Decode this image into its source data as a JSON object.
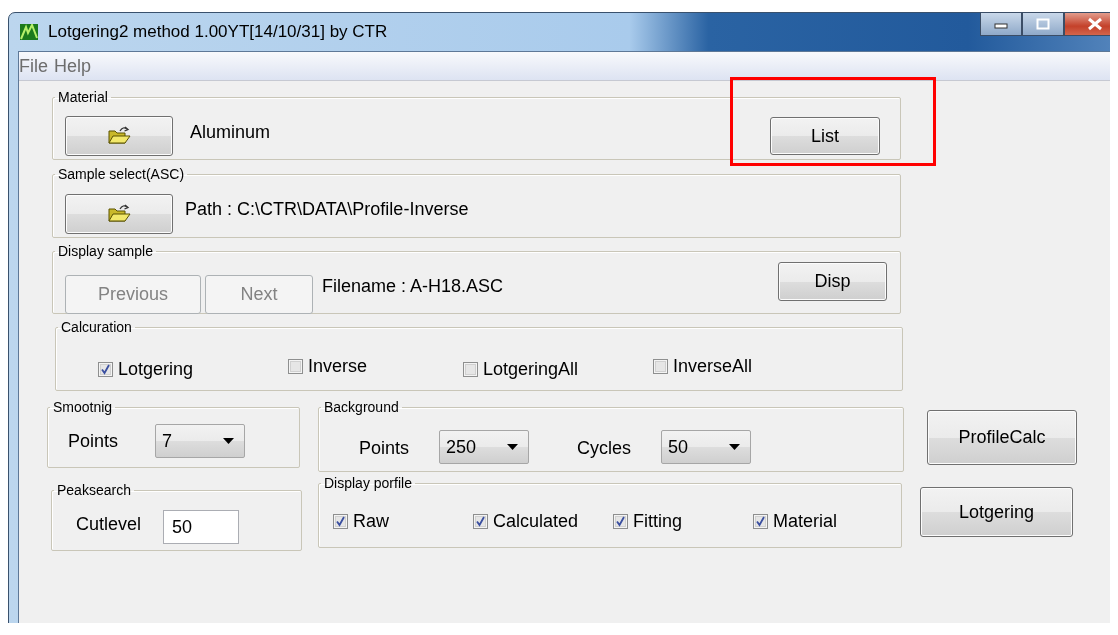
{
  "window": {
    "title": "Lotgering2 method 1.00YT[14/10/31] by CTR"
  },
  "menu": [
    {
      "label": "File"
    },
    {
      "label": "Help"
    }
  ],
  "material": {
    "title": "Material",
    "name": "Aluminum",
    "list_button": "List",
    "highlighted": true
  },
  "sample_select": {
    "title": "Sample select(ASC)",
    "path": "Path : C:\\CTR\\DATA\\Profile-Inverse"
  },
  "display_sample": {
    "title": "Display sample",
    "buttons": [
      {
        "label": "Previous",
        "disabled": true
      },
      {
        "label": "Next",
        "disabled": true
      }
    ],
    "filename": "Filename : A-H18.ASC",
    "disp_button": "Disp"
  },
  "calculation": {
    "title": "Calcuration",
    "options": [
      {
        "label": "Lotgering",
        "checked": true
      },
      {
        "label": "Inverse",
        "checked": false
      },
      {
        "label": "LotgeringAll",
        "checked": false
      },
      {
        "label": "InverseAll",
        "checked": false
      }
    ]
  },
  "smoothing": {
    "title": "Smootnig",
    "label": "Points",
    "value": "7"
  },
  "background": {
    "title": "Background",
    "fields": [
      {
        "label": "Points",
        "value": "250"
      },
      {
        "label": "Cycles",
        "value": "50"
      }
    ]
  },
  "peaksearch": {
    "title": "Peaksearch",
    "label": "Cutlevel",
    "value": "50"
  },
  "display_profile": {
    "title": "Display porfile",
    "options": [
      {
        "label": "Raw",
        "checked": true
      },
      {
        "label": "Calculated",
        "checked": true
      },
      {
        "label": "Fitting",
        "checked": true
      },
      {
        "label": "Material",
        "checked": true
      }
    ]
  },
  "actions": [
    {
      "label": "ProfileCalc"
    },
    {
      "label": "Lotgering"
    }
  ]
}
